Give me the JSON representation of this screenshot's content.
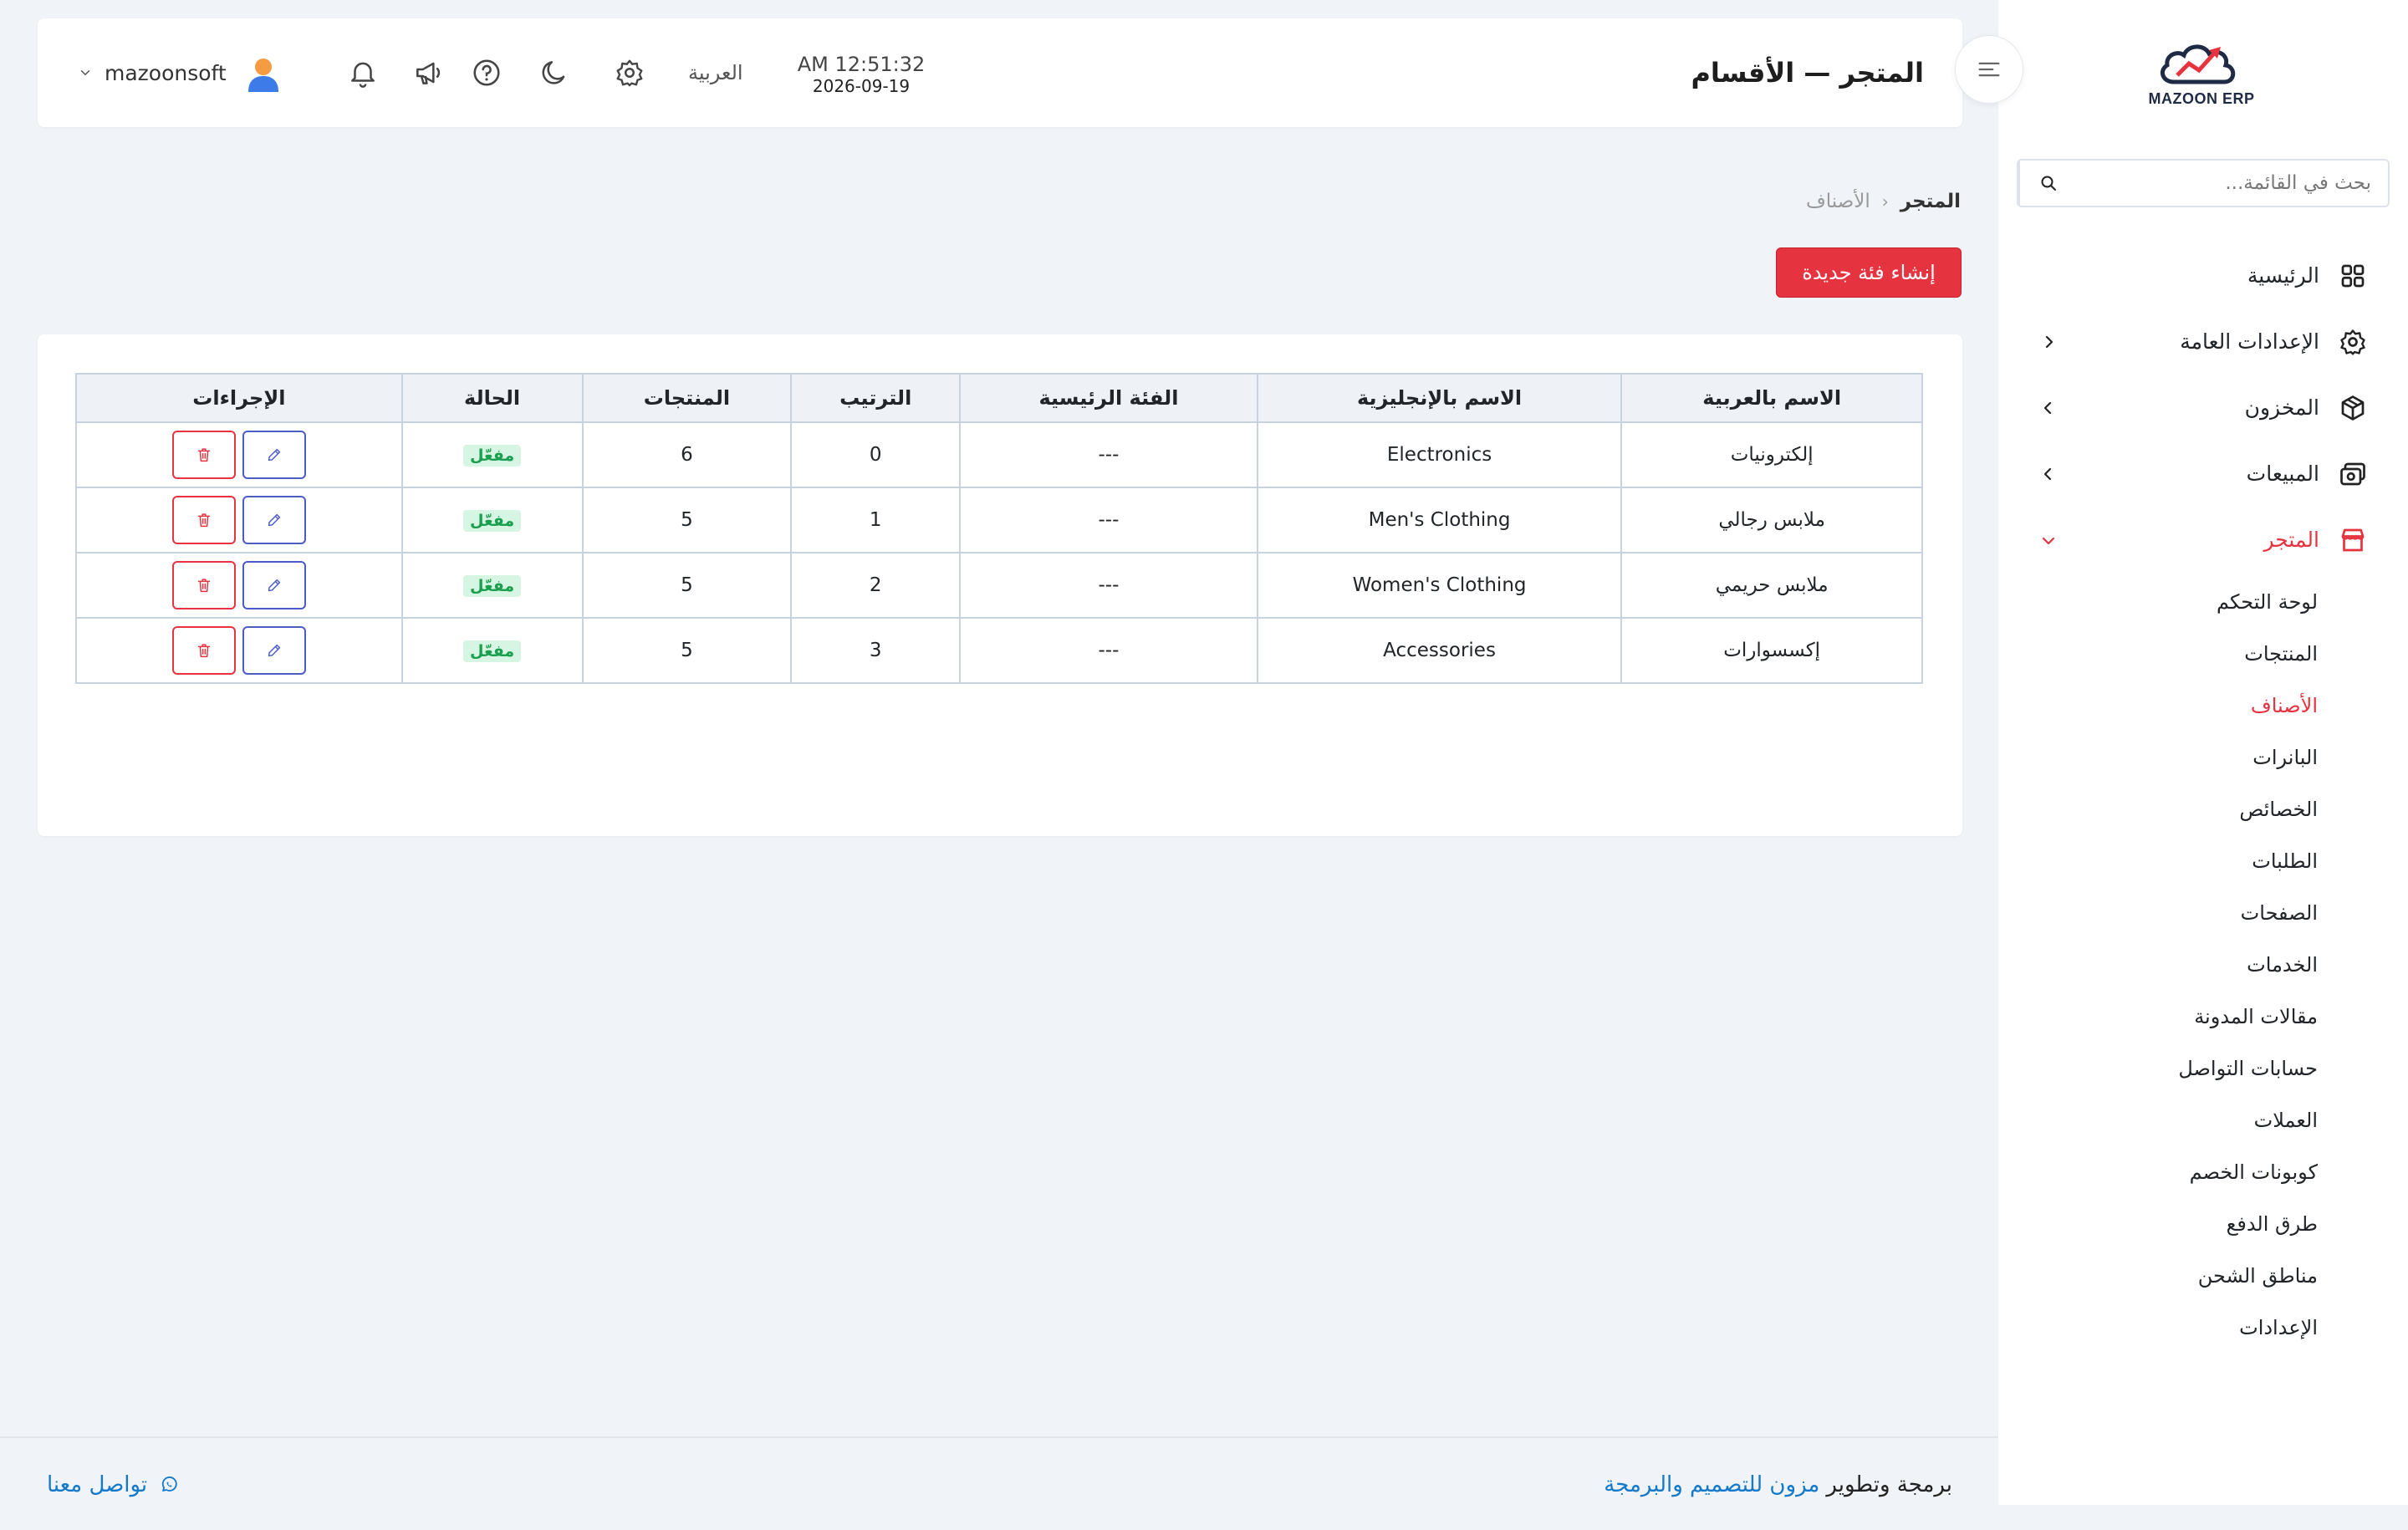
{
  "brand": {
    "name": "MAZOON ERP",
    "accent": "#e5333f"
  },
  "header": {
    "title": "المتجر — الأقسام",
    "time": "AM 12:51:32",
    "date": "2026-09-19",
    "language": "العربية",
    "username": "mazoonsoft",
    "icons": [
      "gear-icon",
      "moon-icon",
      "help-icon",
      "megaphone-icon",
      "bell-icon"
    ]
  },
  "sidebar": {
    "search_placeholder": "بحث في القائمة...",
    "items": [
      {
        "label": "الرئيسية",
        "icon": "grid-icon"
      },
      {
        "label": "الإعدادات العامة",
        "icon": "gear-icon"
      },
      {
        "label": "المخزون",
        "icon": "box-icon"
      },
      {
        "label": "المبيعات",
        "icon": "money-icon"
      },
      {
        "label": "المتجر",
        "icon": "store-icon"
      }
    ],
    "store_subitems": [
      "لوحة التحكم",
      "المنتجات",
      "الأصناف",
      "البانرات",
      "الخصائص",
      "الطلبات",
      "الصفحات",
      "الخدمات",
      "مقالات المدونة",
      "حسابات التواصل",
      "العملات",
      "كوبونات الخصم",
      "طرق الدفع",
      "مناطق الشحن",
      "الإعدادات"
    ]
  },
  "breadcrumb": {
    "root": "المتجر",
    "current": "الأصناف"
  },
  "create_button": "إنشاء فئة جديدة",
  "table": {
    "headers": [
      "الاسم بالعربية",
      "الاسم بالإنجليزية",
      "الفئة الرئيسية",
      "الترتيب",
      "المنتجات",
      "الحالة",
      "الإجراءات"
    ],
    "rows": [
      {
        "name_ar": "إلكترونيات",
        "name_en": "Electronics",
        "parent": "---",
        "order": "0",
        "products": "6",
        "status": "مفعّل"
      },
      {
        "name_ar": "ملابس رجالي",
        "name_en": "Men's Clothing",
        "parent": "---",
        "order": "1",
        "products": "5",
        "status": "مفعّل"
      },
      {
        "name_ar": "ملابس حريمي",
        "name_en": "Women's Clothing",
        "parent": "---",
        "order": "2",
        "products": "5",
        "status": "مفعّل"
      },
      {
        "name_ar": "إكسسوارات",
        "name_en": "Accessories",
        "parent": "---",
        "order": "3",
        "products": "5",
        "status": "مفعّل"
      }
    ]
  },
  "footer": {
    "credit_prefix": "برمجة وتطوير",
    "credit_link": "مزون للتصميم والبرمجة",
    "contact": "تواصل معنا"
  }
}
